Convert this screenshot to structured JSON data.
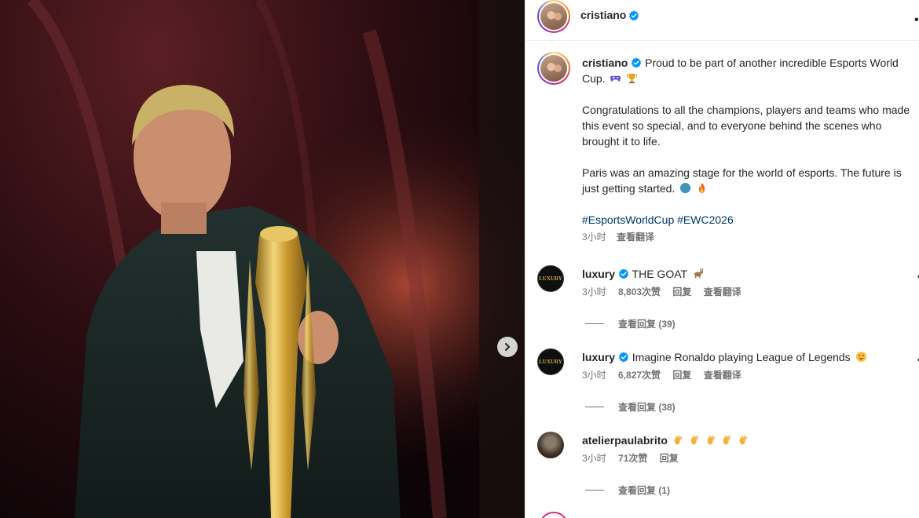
{
  "header": {
    "username": "cristiano"
  },
  "post": {
    "author": "cristiano",
    "caption_p1": "Proud to be part of another incredible Esports World Cup.",
    "caption_p2": "Congratulations to all the champions, players and teams who made this event so special, and to everyone behind the scenes who brought it to life.",
    "caption_p3": "Paris was an amazing stage for the world of esports. The future is just getting started.",
    "hashtags": [
      "#EsportsWorldCup",
      "#EWC2026"
    ],
    "time": "3小时",
    "translate": "查看翻译"
  },
  "comments": [
    {
      "username": "luxury",
      "avatar_text": "LUXURY",
      "text": "THE GOAT",
      "time": "3小时",
      "likes": "8,803次赞",
      "reply": "回复",
      "translate": "查看翻译",
      "view_replies": "查看回复 (39)"
    },
    {
      "username": "luxury",
      "avatar_text": "LUXURY",
      "text": "Imagine Ronaldo playing League of Legends",
      "time": "3小时",
      "likes": "6,827次赞",
      "reply": "回复",
      "translate": "查看翻译",
      "view_replies": "查看回复 (38)"
    },
    {
      "username": "atelierpaulabrito",
      "text": "",
      "time": "3小时",
      "likes": "71次赞",
      "reply": "回复",
      "view_replies": "查看回复 (1)"
    }
  ],
  "icons": {
    "verified": "verified-badge-icon",
    "next": "chevron-right-icon",
    "more": "more-options-icon"
  },
  "colors": {
    "verified": "#0095f6",
    "link": "#00376b",
    "meta": "#737373"
  }
}
